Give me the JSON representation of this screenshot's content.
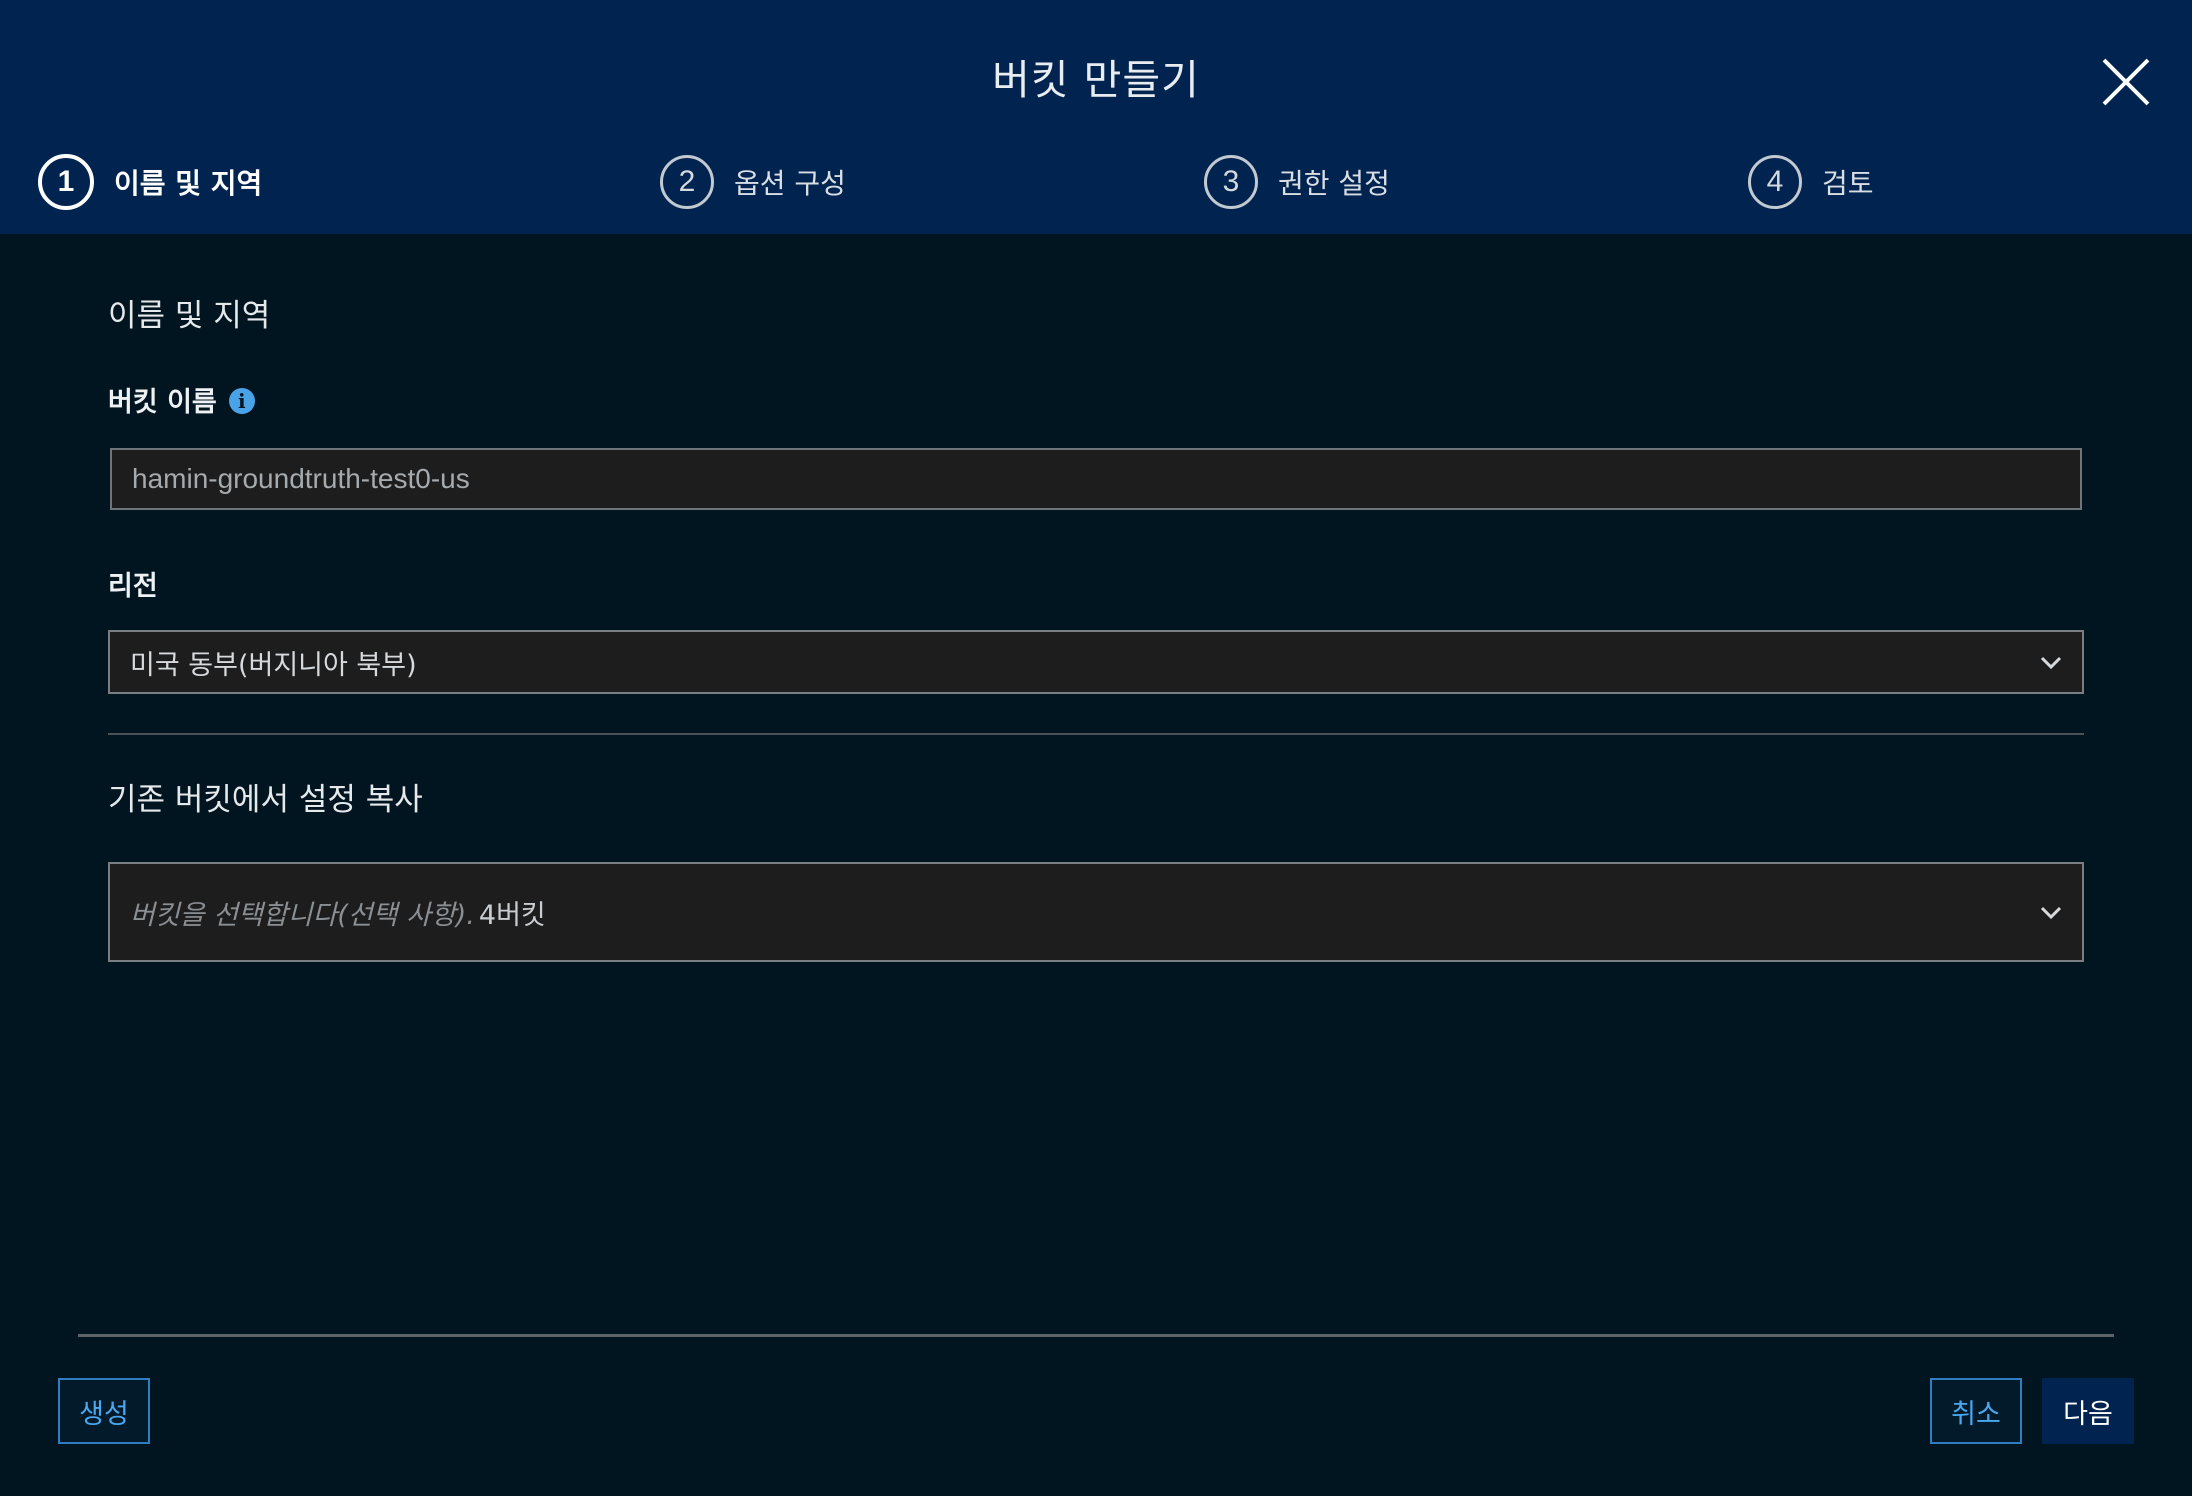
{
  "dialog": {
    "title": "버킷 만들기"
  },
  "steps": [
    {
      "number": "1",
      "label": "이름 및 지역",
      "active": true
    },
    {
      "number": "2",
      "label": "옵션 구성",
      "active": false
    },
    {
      "number": "3",
      "label": "권한 설정",
      "active": false
    },
    {
      "number": "4",
      "label": "검토",
      "active": false
    }
  ],
  "name_region": {
    "section_title": "이름 및 지역",
    "bucket_name_label": "버킷 이름",
    "bucket_name_value": "hamin-groundtruth-test0-us",
    "region_label": "리전",
    "region_value": "미국 동부(버지니아 북부)"
  },
  "copy_settings": {
    "section_title": "기존 버킷에서 설정 복사",
    "select_placeholder": "버킷을 선택합니다(선택 사항).",
    "bucket_count": "4버킷"
  },
  "footer": {
    "create_label": "생성",
    "cancel_label": "취소",
    "next_label": "다음"
  },
  "colors": {
    "header_bg": "#00244f",
    "body_bg": "#011520",
    "accent": "#4aa8f0"
  }
}
